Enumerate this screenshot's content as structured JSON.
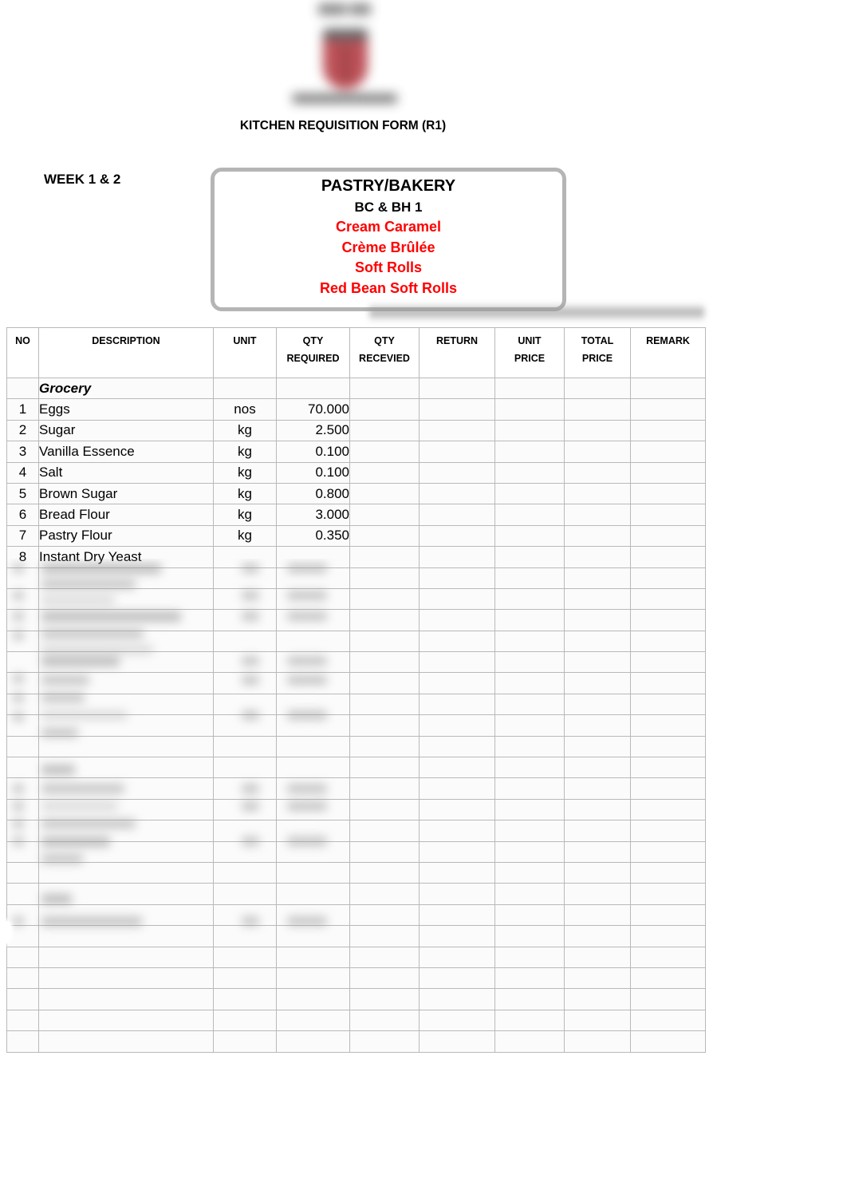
{
  "logo": {
    "name": "institution-crest-logo",
    "text_top": "████ ███",
    "text_bottom": "███████████████████",
    "crest_color": "#b0343c"
  },
  "document": {
    "title": "KITCHEN REQUISITION FORM (R1)",
    "week_label": "WEEK 1 & 2"
  },
  "menu_box": {
    "department": "PASTRY/BAKERY",
    "class_code": "BC & BH 1",
    "accent_color": "#FF0000",
    "items": [
      "Cream Caramel",
      "Crème Brûlée",
      "Soft Rolls",
      "Red Bean Soft Rolls"
    ]
  },
  "table": {
    "columns": [
      {
        "key": "no",
        "label": "NO",
        "label2": ""
      },
      {
        "key": "desc",
        "label": "DESCRIPTION",
        "label2": ""
      },
      {
        "key": "unit",
        "label": "UNIT",
        "label2": ""
      },
      {
        "key": "qtyreq",
        "label": "QTY",
        "label2": "REQUIRED"
      },
      {
        "key": "qtyrec",
        "label": "QTY",
        "label2": "RECEVIED"
      },
      {
        "key": "return",
        "label": "RETURN",
        "label2": ""
      },
      {
        "key": "uprice",
        "label": "UNIT",
        "label2": "PRICE"
      },
      {
        "key": "tprice",
        "label": "TOTAL",
        "label2": "PRICE"
      },
      {
        "key": "remark",
        "label": "REMARK",
        "label2": ""
      }
    ],
    "section_heading": "Grocery",
    "rows": [
      {
        "no": "1",
        "desc": "Eggs",
        "unit": "nos",
        "qtyreq": "70.000",
        "qtyrec": "",
        "return": "",
        "uprice": "",
        "tprice": "",
        "remark": ""
      },
      {
        "no": "2",
        "desc": "Sugar",
        "unit": "kg",
        "qtyreq": "2.500",
        "qtyrec": "",
        "return": "",
        "uprice": "",
        "tprice": "",
        "remark": ""
      },
      {
        "no": "3",
        "desc": "Vanilla Essence",
        "unit": "kg",
        "qtyreq": "0.100",
        "qtyrec": "",
        "return": "",
        "uprice": "",
        "tprice": "",
        "remark": ""
      },
      {
        "no": "4",
        "desc": "Salt",
        "unit": "kg",
        "qtyreq": "0.100",
        "qtyrec": "",
        "return": "",
        "uprice": "",
        "tprice": "",
        "remark": ""
      },
      {
        "no": "5",
        "desc": "Brown Sugar",
        "unit": "kg",
        "qtyreq": "0.800",
        "qtyrec": "",
        "return": "",
        "uprice": "",
        "tprice": "",
        "remark": ""
      },
      {
        "no": "6",
        "desc": "Bread Flour",
        "unit": "kg",
        "qtyreq": "3.000",
        "qtyrec": "",
        "return": "",
        "uprice": "",
        "tprice": "",
        "remark": ""
      },
      {
        "no": "7",
        "desc": "Pastry Flour",
        "unit": "kg",
        "qtyreq": "0.350",
        "qtyrec": "",
        "return": "",
        "uprice": "",
        "tprice": "",
        "remark": ""
      },
      {
        "no": "8",
        "desc": "Instant Dry Yeast",
        "unit": "",
        "qtyreq": "",
        "qtyrec": "",
        "return": "",
        "uprice": "",
        "tprice": "",
        "remark": ""
      }
    ],
    "blank_row_count": 23
  }
}
